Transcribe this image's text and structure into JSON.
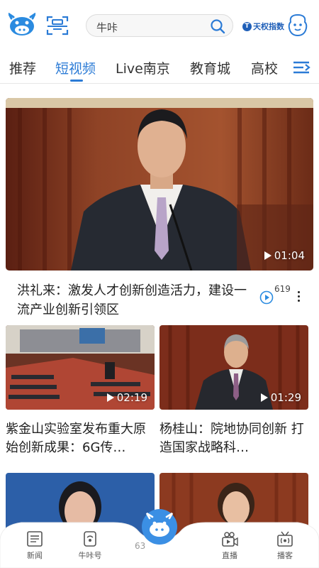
{
  "header": {
    "search_placeholder": "牛咔",
    "brand_label": "天权指数"
  },
  "tabs": [
    {
      "label": "推荐"
    },
    {
      "label": "短视频",
      "active": true
    },
    {
      "label": "Live南京"
    },
    {
      "label": "教育城"
    },
    {
      "label": "高校"
    }
  ],
  "feed": {
    "hero": {
      "duration": "01:04",
      "title": "洪礼来：激发人才创新创造活力，建设一流产业创新引领区",
      "views": "619"
    },
    "grid": [
      {
        "duration": "02:19",
        "title": "紫金山实验室发布重大原始创新成果：6G传…"
      },
      {
        "duration": "01:29",
        "title": "杨桂山：院地协同创新 打造国家战略科…"
      }
    ]
  },
  "bottom_nav": [
    {
      "label": "新闻",
      "icon": "newspaper-icon"
    },
    {
      "label": "牛咔号",
      "icon": "broadcast-phone-icon"
    },
    {
      "label": "直播",
      "icon": "video-camera-icon"
    },
    {
      "label": "播客",
      "icon": "radio-icon"
    }
  ],
  "fab_badge": "63",
  "colors": {
    "accent": "#2b7bd6",
    "brand": "#1f5fb8"
  }
}
